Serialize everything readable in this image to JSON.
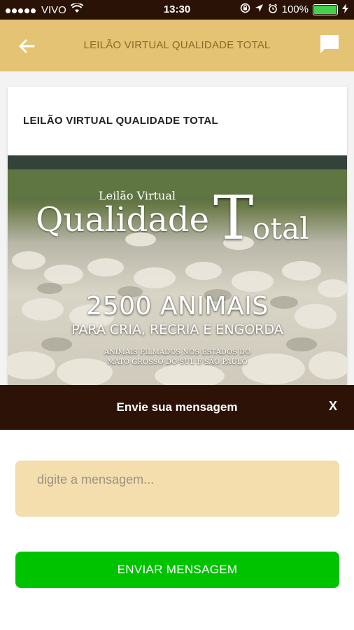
{
  "status_bar": {
    "carrier": "VIVO",
    "time": "13:30",
    "battery": "100%",
    "battery_level": 1.0,
    "icons": [
      "signal-dots-icon",
      "wifi-icon",
      "screen-lock-icon",
      "location-arrow-icon",
      "alarm-icon",
      "battery-icon"
    ]
  },
  "app_bar": {
    "title": "LEILÃO VIRTUAL QUALIDADE TOTAL",
    "back_icon": "arrow-left-icon",
    "chat_icon": "chat-bubble-icon",
    "background": "#e4c374",
    "title_color": "#8b6a25"
  },
  "card": {
    "title": "LEILÃO VIRTUAL QUALIDADE TOTAL",
    "banner": {
      "small_heading": "Leilão Virtual",
      "title_part1": "Qualidade",
      "title_part2_big": "T",
      "title_part2_rest": "otal",
      "headline": "2500 ANIMAIS",
      "subheadline": "PARA CRIA, RECRIA E ENGORDA",
      "fine_line1": "ANIMAIS FILMADOS NOS ESTADOS DO",
      "fine_line2": "MATO GROSSO DO SUL E SÃO PAULO"
    }
  },
  "message_sheet": {
    "title": "Envie sua mensagem",
    "close_label": "X",
    "header_color": "#2d1307",
    "input_placeholder": "digite a mensagem...",
    "input_value": "",
    "send_label": "ENVIAR MENSAGEM",
    "send_color": "#00c300"
  }
}
